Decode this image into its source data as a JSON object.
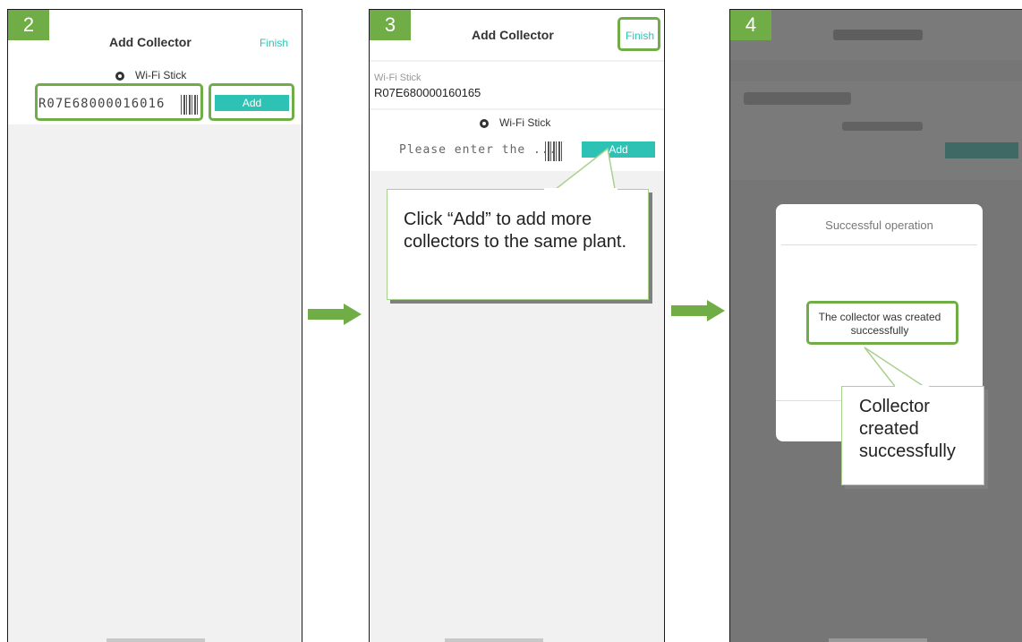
{
  "colors": {
    "accent_teal": "#2ec2b5",
    "highlight_green": "#70ad47",
    "callout_green": "#a9d18e"
  },
  "panel2": {
    "step": "2",
    "title": "Add Collector",
    "finish": "Finish",
    "radio_label": "Wi-Fi Stick",
    "serial_value": "R07E68000016016",
    "add_label": "Add"
  },
  "panel3": {
    "step": "3",
    "title": "Add Collector",
    "finish": "Finish",
    "existing_type": "Wi-Fi Stick",
    "existing_serial": "R07E680000160165",
    "radio_label": "Wi-Fi Stick",
    "serial_placeholder": "Please enter the ...",
    "add_label": "Add",
    "callout": "Click “Add” to add more collectors to the same plant."
  },
  "panel4": {
    "step": "4",
    "modal_title": "Successful operation",
    "modal_message": "The collector was created successfully",
    "callout": "Collector created successfully"
  }
}
